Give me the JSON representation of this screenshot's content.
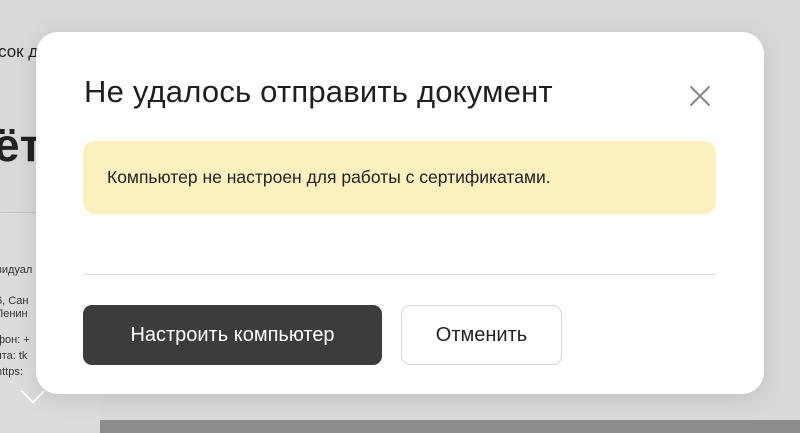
{
  "background": {
    "breadcrumb": "сок д",
    "heading": "ёт",
    "lines": [
      "видуал",
      "6, Сан",
      "Ленин",
      "фон: +",
      "чта: tk",
      "https:"
    ]
  },
  "dialog": {
    "title": "Не удалось отправить документ",
    "close_icon": "close-icon",
    "alert": {
      "text": "Компьютер не настроен для работы с сертификатами.",
      "color": "#fdf0bf"
    },
    "primary_button": "Настроить компьютер",
    "secondary_button": "Отменить",
    "primary_color": "#3c3c3c"
  }
}
